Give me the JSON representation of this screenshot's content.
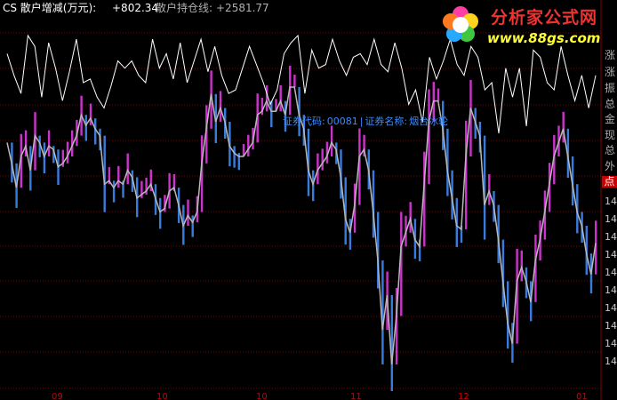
{
  "header": {
    "title": "CS 散户增减(万元):",
    "value1": "+802.34",
    "label2": "散户持仓线:",
    "value2": "+2581.77"
  },
  "info": {
    "code_label": "证券代码:",
    "code_value": "00081",
    "name_label": "证券名称:",
    "name_value": "烟台冰轮"
  },
  "logo": {
    "text": "分析家公式网",
    "url": "www.88gs.com"
  },
  "right_panel": {
    "labels": [
      "涨",
      "涨",
      "振",
      "总",
      "金",
      "现",
      "总",
      "外"
    ],
    "highlight": "点",
    "numbers": [
      "14",
      "14",
      "14",
      "14",
      "14",
      "14",
      "14",
      "14",
      "14",
      "14"
    ]
  },
  "x_labels": [
    "09",
    "10",
    "10",
    "11",
    "12",
    "01"
  ],
  "colors": {
    "background": "#000000",
    "up_bar": "#cc33cc",
    "down_bar": "#3a7cdd",
    "retail_line": "#ffffff",
    "holding_line": "#b8b8b8",
    "grid": "#800000",
    "info_text": "#3a8cff"
  },
  "chart_data": {
    "type": "line",
    "series": [
      {
        "name": "散户增减(万元)",
        "values": [
          150,
          120,
          95,
          175,
          160,
          90,
          165,
          130,
          85,
          125,
          170,
          110,
          115,
          90,
          75,
          105,
          140,
          130,
          140,
          120,
          110,
          170,
          130,
          150,
          115,
          165,
          110,
          140,
          170,
          125,
          160,
          120,
          95,
          100,
          130,
          160,
          135,
          110,
          80,
          100,
          150,
          165,
          175,
          95,
          155,
          130,
          135,
          170,
          140,
          120,
          145,
          150,
          135,
          170,
          135,
          125,
          165,
          130,
          80,
          100,
          55,
          145,
          115,
          140,
          170,
          135,
          120,
          160,
          145,
          100,
          110,
          40,
          130,
          90,
          130,
          50,
          155,
          145,
          110,
          100,
          160,
          120,
          85,
          120,
          75,
          120
        ]
      },
      {
        "name": "散户持仓线",
        "values": [
          2620,
          2590,
          2555,
          2600,
          2615,
          2580,
          2630,
          2620,
          2600,
          2615,
          2610,
          2585,
          2590,
          2600,
          2615,
          2630,
          2660,
          2645,
          2655,
          2640,
          2630,
          2560,
          2565,
          2555,
          2565,
          2560,
          2580,
          2570,
          2540,
          2545,
          2550,
          2560,
          2540,
          2520,
          2525,
          2550,
          2555,
          2530,
          2500,
          2515,
          2505,
          2520,
          2590,
          2640,
          2690,
          2650,
          2670,
          2650,
          2615,
          2605,
          2600,
          2600,
          2610,
          2620,
          2660,
          2665,
          2680,
          2665,
          2665,
          2680,
          2660,
          2700,
          2700,
          2660,
          2640,
          2580,
          2560,
          2580,
          2590,
          2600,
          2620,
          2610,
          2570,
          2510,
          2490,
          2530,
          2600,
          2610,
          2580,
          2520,
          2450,
          2350,
          2400,
          2300,
          2370,
          2470,
          2490,
          2510,
          2480,
          2470,
          2560,
          2650,
          2680,
          2680,
          2640,
          2580,
          2540,
          2500,
          2495,
          2600,
          2670,
          2650,
          2630,
          2530,
          2550,
          2530,
          2480,
          2420,
          2360,
          2330,
          2420,
          2440,
          2420,
          2390,
          2450,
          2480,
          2520,
          2560,
          2600,
          2620,
          2640,
          2600,
          2560,
          2520,
          2500,
          2460,
          2430,
          2475
        ]
      }
    ],
    "bars": {
      "up_color": "#cc33cc",
      "down_color": "#3a7cdd"
    },
    "grid": true
  }
}
